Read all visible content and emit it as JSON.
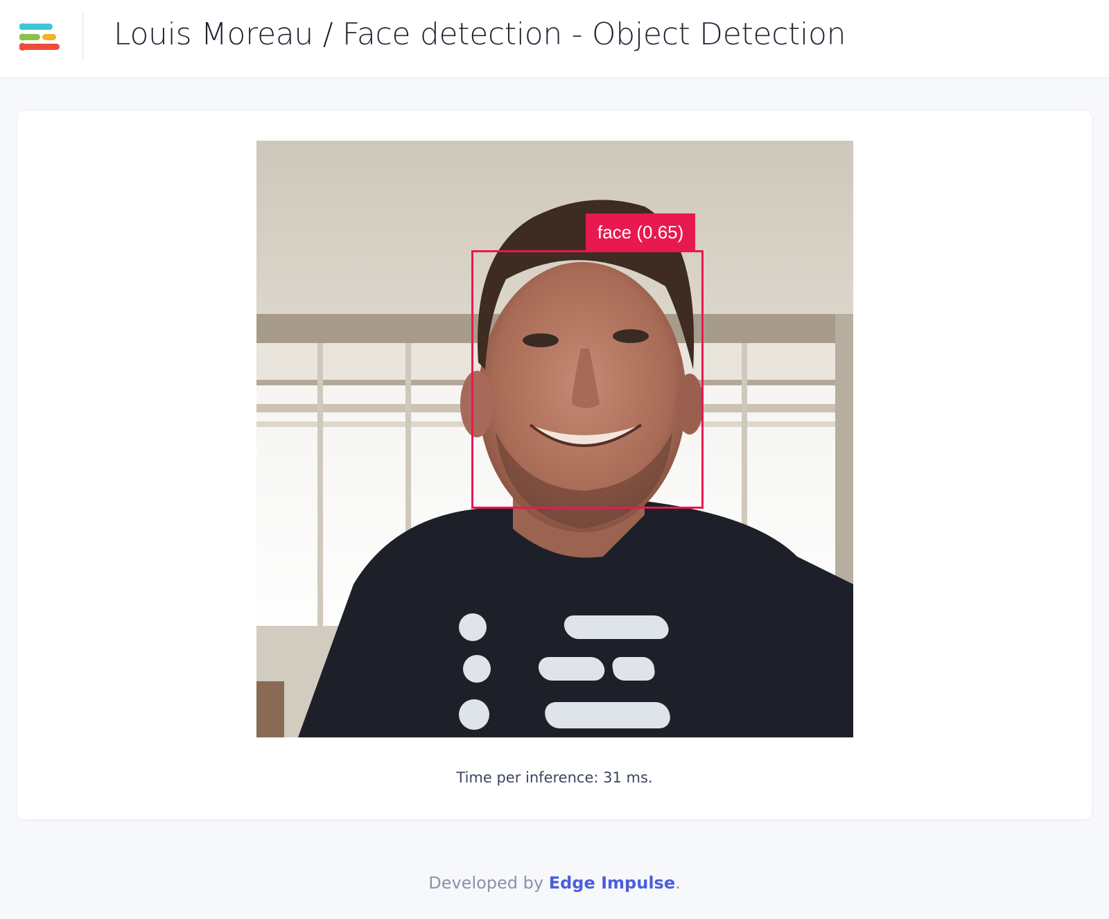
{
  "header": {
    "title": "Louis Moreau / Face detection - Object Detection",
    "logo_icon": "edge-impulse-logo-icon",
    "logo_colors": [
      "#40c4d8",
      "#8bc34a",
      "#f5b323",
      "#ef4b3a"
    ]
  },
  "camera": {
    "image_description_icon": "camera-frame-image",
    "detections": [
      {
        "label": "face (0.65)",
        "class": "face",
        "confidence": 0.65,
        "color": "#e8194f"
      }
    ]
  },
  "inference": {
    "text": "Time per inference: 31 ms."
  },
  "footer": {
    "prefix": "Developed by ",
    "link_text": "Edge Impulse",
    "suffix": ".",
    "link_color": "#4a5fdc"
  }
}
